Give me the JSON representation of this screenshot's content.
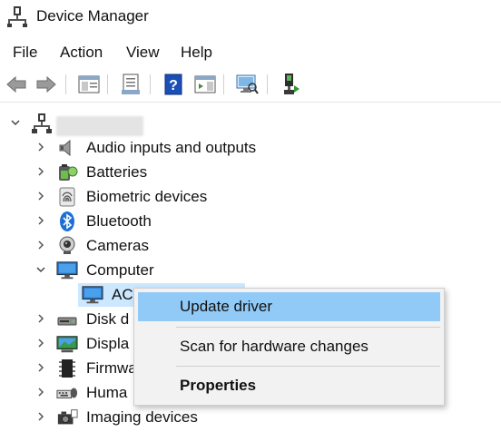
{
  "window": {
    "title": "Device Manager"
  },
  "menubar": {
    "items": [
      "File",
      "Action",
      "View",
      "Help"
    ]
  },
  "tree": {
    "categories": [
      {
        "label": "Audio inputs and outputs",
        "icon": "speaker-icon",
        "expanded": false
      },
      {
        "label": "Batteries",
        "icon": "battery-icon",
        "expanded": false
      },
      {
        "label": "Biometric devices",
        "icon": "fingerprint-icon",
        "expanded": false
      },
      {
        "label": "Bluetooth",
        "icon": "bluetooth-icon",
        "expanded": false
      },
      {
        "label": "Cameras",
        "icon": "camera-icon",
        "expanded": false
      },
      {
        "label": "Computer",
        "icon": "monitor-icon",
        "expanded": true
      },
      {
        "label": "Disk d",
        "icon": "disk-drive-icon",
        "expanded": false
      },
      {
        "label": "Displa",
        "icon": "display-adapter-icon",
        "expanded": false
      },
      {
        "label": "Firmwa",
        "icon": "firmware-chip-icon",
        "expanded": false
      },
      {
        "label": "Huma",
        "icon": "hid-keyboard-icon",
        "expanded": false
      },
      {
        "label": "Imaging devices",
        "icon": "imaging-camera-icon",
        "expanded": false
      }
    ],
    "computer_child": {
      "label": "AC",
      "icon": "monitor-icon"
    }
  },
  "context_menu": {
    "items": [
      {
        "label": "Update driver",
        "highlighted": true,
        "bold": false
      },
      {
        "label": "Scan for hardware changes",
        "highlighted": false,
        "bold": false
      },
      {
        "label": "Properties",
        "highlighted": false,
        "bold": true
      }
    ]
  },
  "colors": {
    "selection": "#cce8ff",
    "menu_highlight": "#91c9f7",
    "help_blue": "#1a4fb8"
  }
}
